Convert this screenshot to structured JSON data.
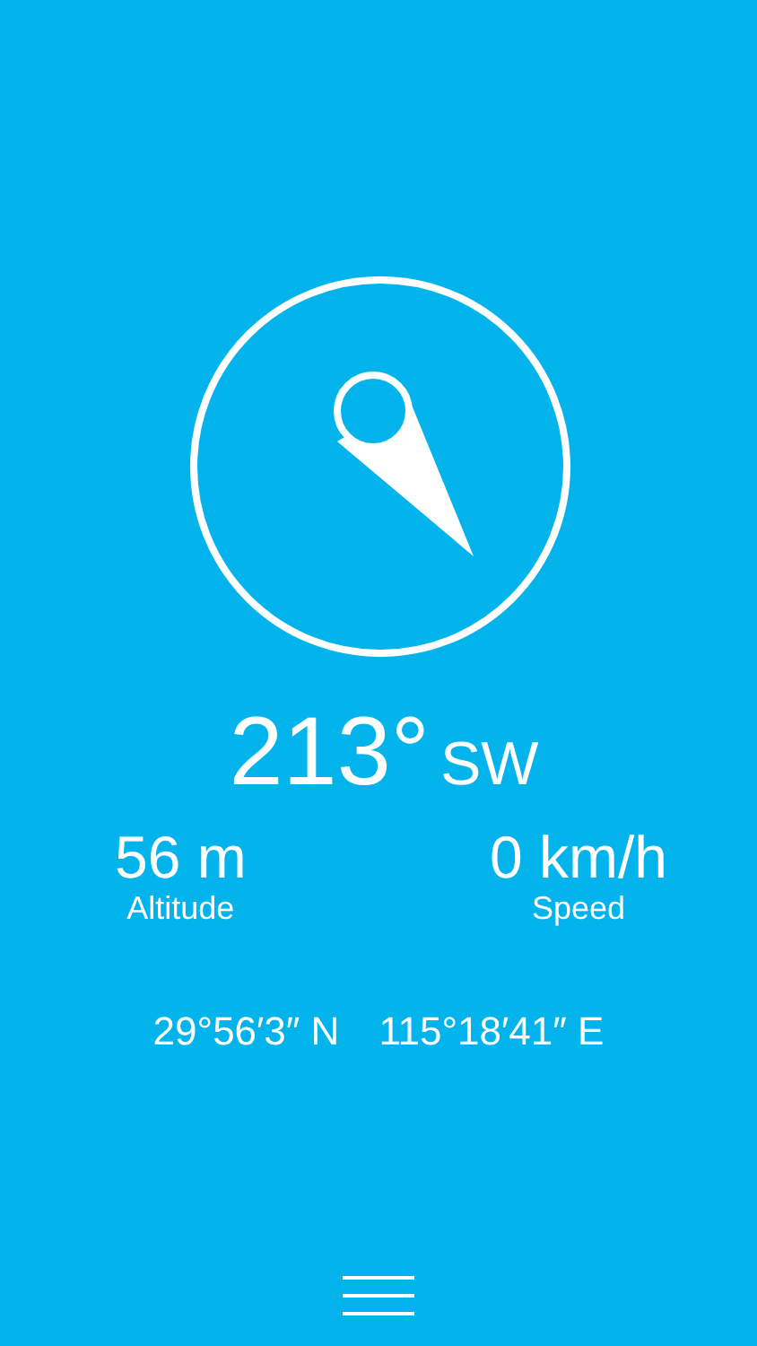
{
  "heading": {
    "degrees": "213°",
    "direction": "SW"
  },
  "stats": [
    {
      "value": "56 m",
      "label": "Altitude"
    },
    {
      "value": "0 km/h",
      "label": "Speed"
    }
  ],
  "coordinates": {
    "latitude": "29°56′3″ N",
    "longitude": "115°18′41″ E"
  }
}
